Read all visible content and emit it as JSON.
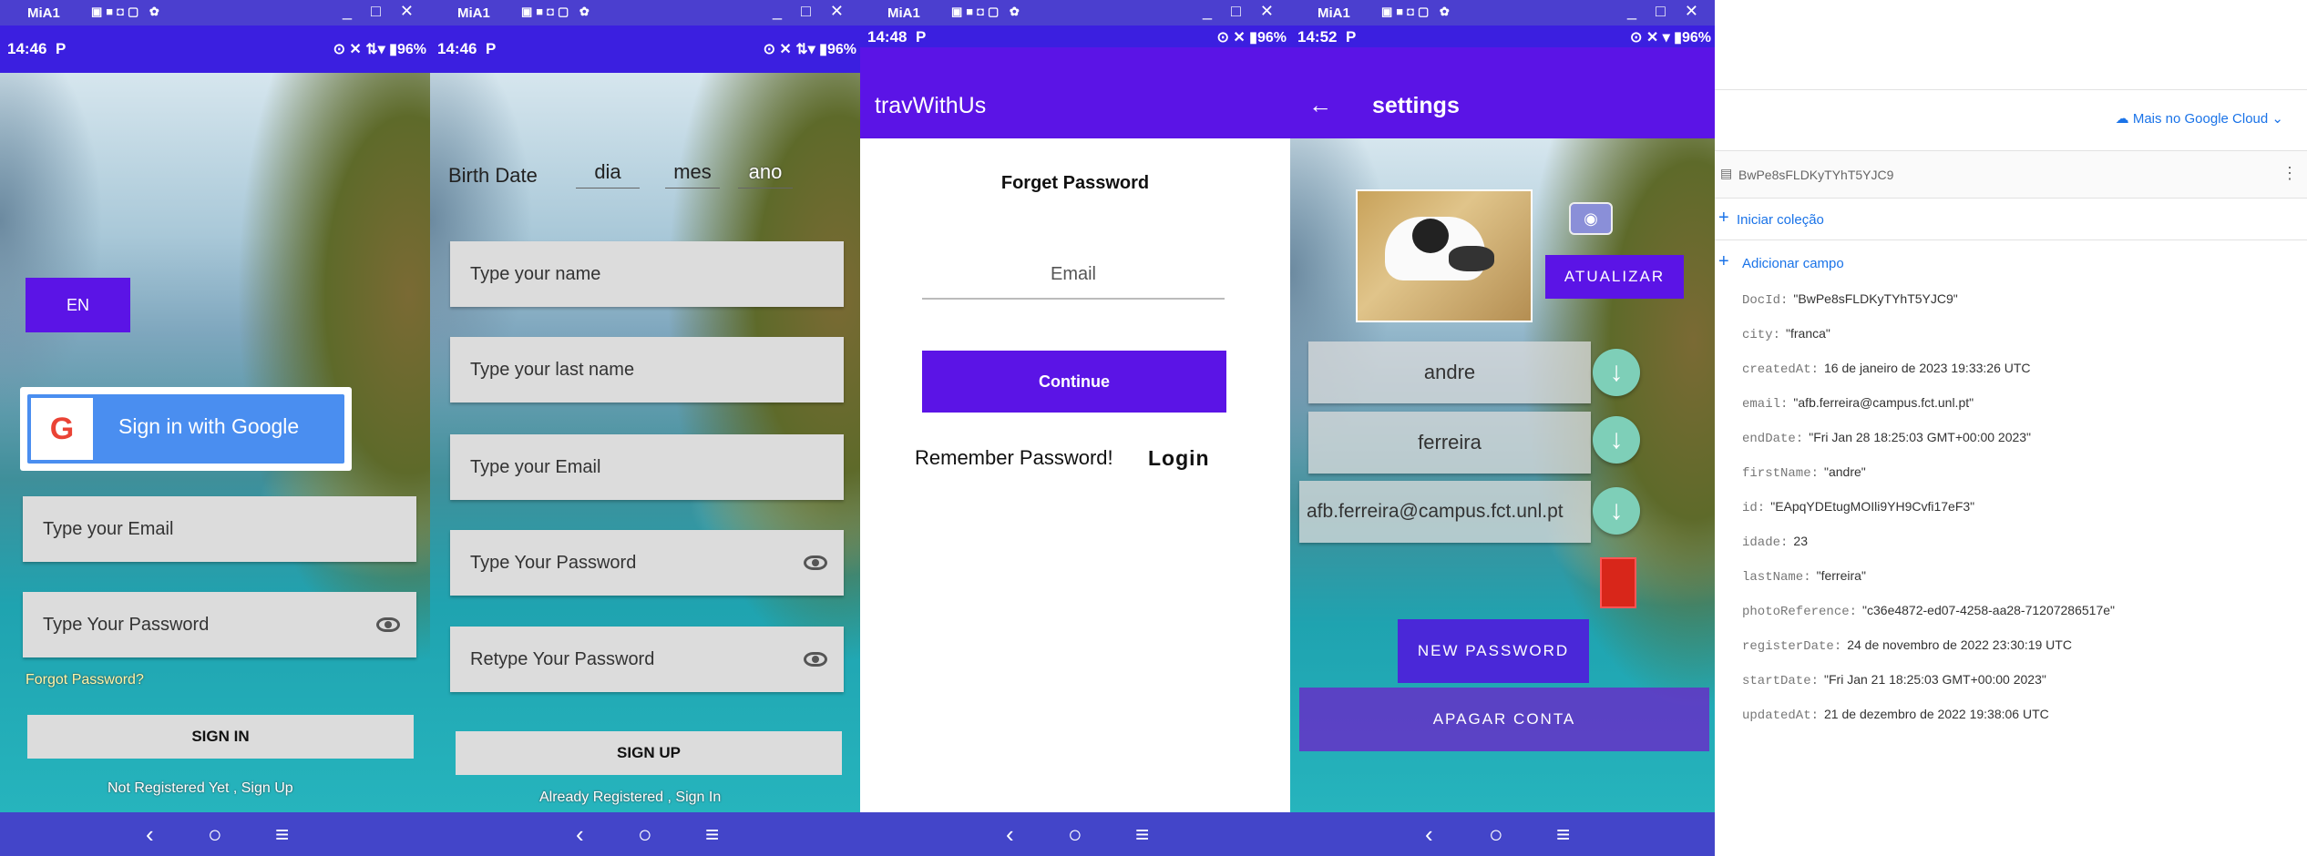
{
  "screens": [
    {
      "win_title": "MiA1",
      "time": "14:46",
      "p": "P",
      "status": "⊙ ✕ ⇅▾ ▮96%"
    },
    {
      "win_title": "MiA1",
      "time": "14:46",
      "p": "P",
      "status": "⊙ ✕ ⇅▾ ▮96%"
    },
    {
      "win_title": "MiA1",
      "time": "14:48",
      "p": "P",
      "status": "⊙ ✕ ▮96%"
    },
    {
      "win_title": "MiA1",
      "time": "14:52",
      "p": "P",
      "status": "⊙ ✕ ▾ ▮96%"
    }
  ],
  "win_icons": "▣■◘▢ ✿",
  "win_controls": "_ □ ✕",
  "nav": {
    "back": "‹",
    "home": "○",
    "menu": "≡"
  },
  "login": {
    "lang": "EN",
    "google": "Sign in with Google",
    "email_ph": "Type your Email",
    "password_ph": "Type Your Password",
    "forgot": "Forgot Password?",
    "signin": "SIGN IN",
    "register": "Not Registered Yet , Sign Up"
  },
  "signup": {
    "birth": "Birth Date",
    "dia": "dia",
    "mes": "mes",
    "ano": "ano",
    "name": "Type your name",
    "lastname": "Type your last name",
    "email": "Type your Email",
    "password": "Type Your Password",
    "retype": "Retype Your Password",
    "signup": "SIGN UP",
    "already": "Already Registered , Sign In"
  },
  "forget": {
    "appbar": "travWithUs",
    "title": "Forget Password",
    "email_ph": "Email",
    "continue": "Continue",
    "remember": "Remember Password!",
    "login": "Login"
  },
  "settings": {
    "appbar": "settings",
    "update": "ATUALIZAR",
    "first": "andre",
    "last": "ferreira",
    "email": "afb.ferreira@campus.fct.unl.pt",
    "newpass": "NEW PASSWORD",
    "delete": "APAGAR CONTA"
  },
  "firestore": {
    "cloud": "Mais no Google Cloud",
    "doc": "BwPe8sFLDKyTYhT5YJC9",
    "start_collection": "Iniciar coleção",
    "add_field": "Adicionar campo",
    "fields": [
      {
        "k": "DocId:",
        "v": "\"BwPe8sFLDKyTYhT5YJC9\""
      },
      {
        "k": "city:",
        "v": "\"franca\""
      },
      {
        "k": "createdAt:",
        "v": "16 de janeiro de 2023 19:33:26 UTC"
      },
      {
        "k": "email:",
        "v": "\"afb.ferreira@campus.fct.unl.pt\""
      },
      {
        "k": "endDate:",
        "v": "\"Fri Jan 28 18:25:03 GMT+00:00 2023\""
      },
      {
        "k": "firstName:",
        "v": "\"andre\""
      },
      {
        "k": "id:",
        "v": "\"EApqYDEtugMOIli9YH9Cvfi17eF3\""
      },
      {
        "k": "idade:",
        "v": "23"
      },
      {
        "k": "lastName:",
        "v": "\"ferreira\""
      },
      {
        "k": "photoReference:",
        "v": "\"c36e4872-ed07-4258-aa28-71207286517e\""
      },
      {
        "k": "registerDate:",
        "v": "24 de novembro de 2022 23:30:19 UTC"
      },
      {
        "k": "startDate:",
        "v": "\"Fri Jan 21 18:25:03 GMT+00:00 2023\""
      },
      {
        "k": "updatedAt:",
        "v": "21 de dezembro de 2022 19:38:06 UTC"
      }
    ]
  },
  "colors": {
    "purple": "#5b14e6",
    "statusbar": "#3b1fe0",
    "navbar": "#4345c9",
    "google_blue": "#4a8ef0"
  }
}
